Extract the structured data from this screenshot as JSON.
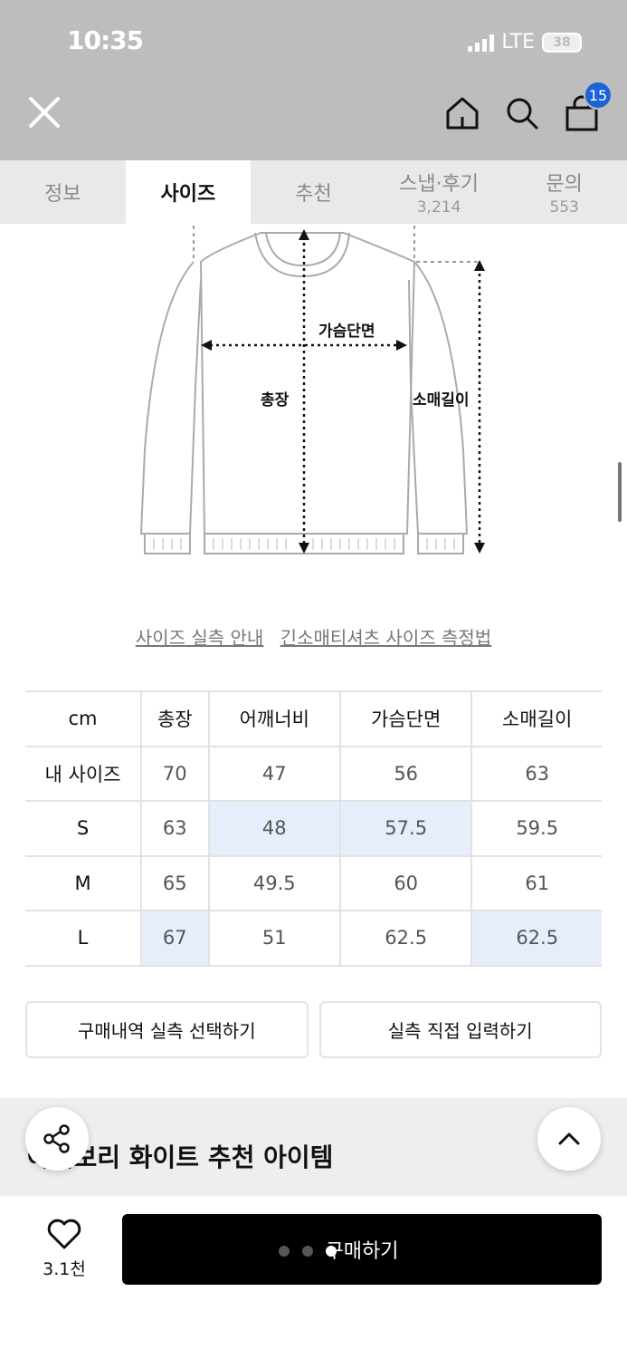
{
  "status": {
    "time": "10:35",
    "network": "LTE",
    "battery": "38"
  },
  "nav": {
    "cart_count": "15"
  },
  "tabs": [
    {
      "label": "정보",
      "count": ""
    },
    {
      "label": "사이즈",
      "count": ""
    },
    {
      "label": "추천",
      "count": ""
    },
    {
      "label": "스냅·후기",
      "count": "3,214"
    },
    {
      "label": "문의",
      "count": "553"
    }
  ],
  "diagram": {
    "chest": "가슴단면",
    "length": "총장",
    "sleeve": "소매길이"
  },
  "guide": {
    "link1": "사이즈 실측 안내",
    "link2": "긴소매티셔츠 사이즈 측정법"
  },
  "table": {
    "headers": [
      "cm",
      "총장",
      "어깨너비",
      "가슴단면",
      "소매길이"
    ],
    "rows": [
      {
        "label": "내 사이즈",
        "values": [
          "70",
          "47",
          "56",
          "63"
        ]
      },
      {
        "label": "S",
        "values": [
          "63",
          "48",
          "57.5",
          "59.5"
        ]
      },
      {
        "label": "M",
        "values": [
          "65",
          "49.5",
          "60",
          "61"
        ]
      },
      {
        "label": "L",
        "values": [
          "67",
          "51",
          "62.5",
          "62.5"
        ]
      }
    ]
  },
  "actions": {
    "history": "구매내역 실측 선택하기",
    "manual": "실측 직접 입력하기"
  },
  "reco": {
    "title": "아이보리 화이트 추천 아이템"
  },
  "bottom": {
    "likes": "3.1천",
    "buy": "구매하기"
  }
}
